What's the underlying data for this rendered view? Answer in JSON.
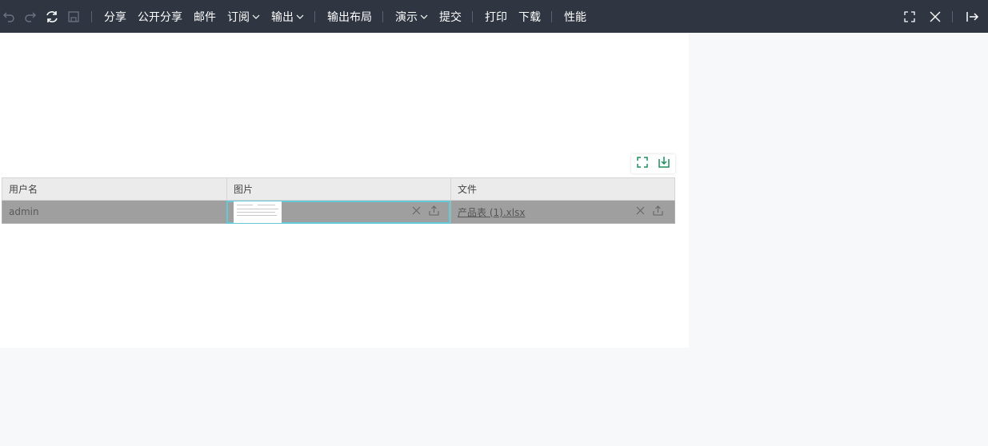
{
  "toolbar": {
    "items": [
      "分享",
      "公开分享",
      "邮件",
      "订阅",
      "输出",
      "输出布局",
      "演示",
      "提交",
      "打印",
      "下载",
      "性能"
    ]
  },
  "table": {
    "headers": [
      "用户名",
      "图片",
      "文件"
    ],
    "rows": [
      {
        "username": "admin",
        "file": "产品表 (1).xlsx"
      }
    ]
  },
  "colors": {
    "toolbar_bg": "#2f3541",
    "accent_green": "#1f8f5f",
    "selection_outline": "#64c8d6",
    "row_bg": "#9f9f9f"
  },
  "icons": {
    "undo": "undo-icon",
    "redo": "redo-icon",
    "refresh": "refresh-icon",
    "save": "save-icon",
    "fullscreen": "fullscreen-icon",
    "close": "close-icon",
    "exit": "exit-icon",
    "export": "export-icon",
    "clear": "clear-icon",
    "upload": "upload-icon"
  }
}
